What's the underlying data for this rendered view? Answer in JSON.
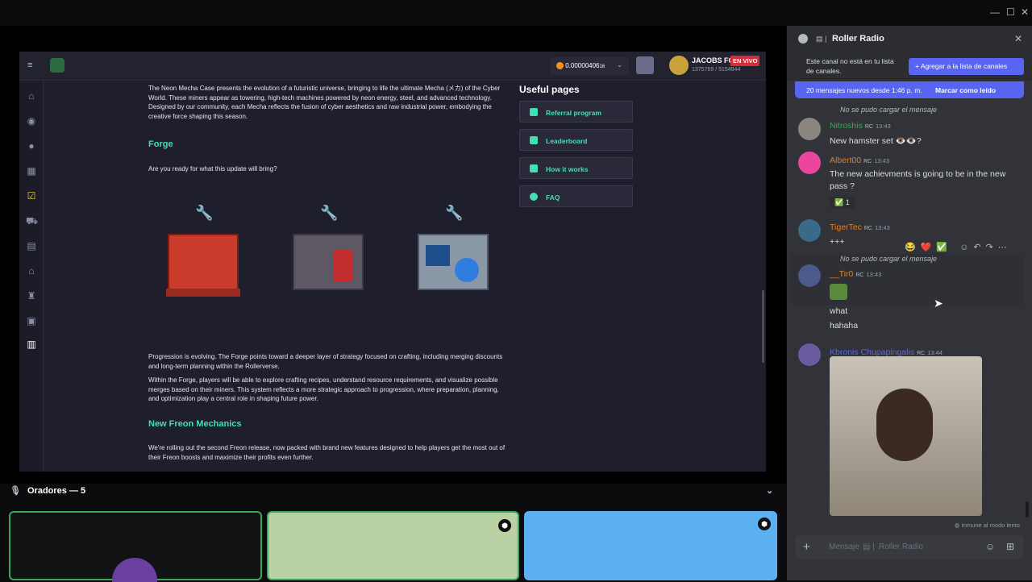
{
  "site": {
    "balance": "0.00000406",
    "balance_suffix": "16",
    "username": "JACOBS FC",
    "live_badge": "EN VIVO",
    "stats": "1375769 / 5154844",
    "article_intro_bold": "Neon Mecha Case",
    "article_intro": "The Neon Mecha Case presents the evolution of a futuristic universe, bringing to life the ultimate Mecha (メカ) of the Cyber World. These miners appear as towering, high-tech machines powered by neon energy, steel, and advanced technology. Designed by our community, each Mecha reflects the fusion of cyber aesthetics and raw industrial power, embodying the creative force shaping this season.",
    "forge_heading": "Forge",
    "forge_question": "Are you ready for what this update will bring?",
    "progression_text": "Progression is evolving. The Forge points toward a deeper layer of strategy focused on crafting, including merging discounts and long-term planning within the Rollerverse.",
    "within_text": "Within the Forge, players will be able to explore crafting recipes, understand resource requirements, and visualize possible merges based on their miners. This system reflects a more strategic approach to progression, where preparation, planning, and optimization play a central role in shaping future power.",
    "freon_heading": "New Freon Mechanics",
    "freon_text": "We're rolling out the second Freon release, now packed with brand new features designed to help players get the most out of their Freon boosts and maximize their profits even further.",
    "useful_title": "Useful pages",
    "useful_pages": [
      "Referral program",
      "Leaderboard",
      "How it works",
      "FAQ"
    ]
  },
  "voice": {
    "speakers_label": "Oradores — 5"
  },
  "chat": {
    "channel_name": "Roller Radio",
    "not_in_list": "Este canal no está en tu lista de canales.",
    "add_button": "Agregar a la lista de canales",
    "new_messages": "20 mensajes nuevos desde 1:46 p. m.",
    "mark_read": "Marcar como leído",
    "failed_load": "No se pudo cargar el mensaje",
    "messages": [
      {
        "user": "Nitroshis",
        "color": "#3ba55d",
        "time": "13:43",
        "text": "New hamster set 👁️👁️?"
      },
      {
        "user": "Albert00",
        "color": "#e67e22",
        "time": "13:43",
        "text": "The new achievments is going to be in the new pass ?",
        "reaction": "✅",
        "reaction_count": "1"
      },
      {
        "user": "TigerTec",
        "color": "#e67e22",
        "time": "13:43",
        "text": "+++"
      },
      {
        "user": "__Tir0",
        "color": "#e67e22",
        "time": "13:43",
        "text": "what",
        "text2": "hahaha"
      },
      {
        "user": "Kbronis Chupapingalis",
        "color": "#5865f2",
        "time": "13:44",
        "text": ""
      }
    ],
    "rc_badge": "RC",
    "slow_mode": "Inmune al modo lento",
    "input_placeholder": "Mensaje",
    "input_channel": "Roller Radio"
  }
}
